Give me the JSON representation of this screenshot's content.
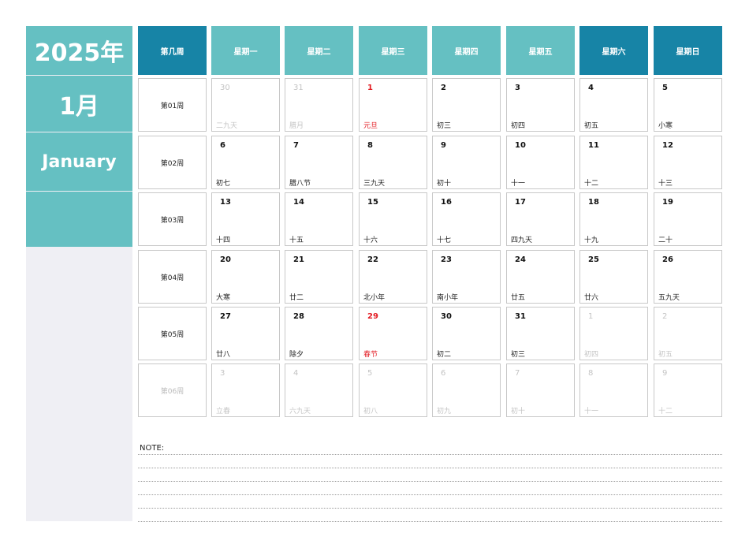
{
  "sidebar": {
    "year": "2025年",
    "month": "1月",
    "month_en": "January"
  },
  "colors": {
    "accent": "#65c0c2",
    "weekend": "#1784a6",
    "sidebar_bg": "#efeff4",
    "holiday": "#e31c23",
    "dim": "#c4c4c4"
  },
  "headers": [
    "第几周",
    "星期一",
    "星期二",
    "星期三",
    "星期四",
    "星期五",
    "星期六",
    "星期日"
  ],
  "weeks": [
    {
      "label": "第01周",
      "dim": false,
      "days": [
        {
          "num": "30",
          "lunar": "二九天",
          "dim": true
        },
        {
          "num": "31",
          "lunar": "腊月",
          "dim": true
        },
        {
          "num": "1",
          "lunar": "元旦",
          "holiday": true
        },
        {
          "num": "2",
          "lunar": "初三"
        },
        {
          "num": "3",
          "lunar": "初四"
        },
        {
          "num": "4",
          "lunar": "初五"
        },
        {
          "num": "5",
          "lunar": "小寒"
        }
      ]
    },
    {
      "label": "第02周",
      "dim": false,
      "days": [
        {
          "num": "6",
          "lunar": "初七"
        },
        {
          "num": "7",
          "lunar": "腊八节"
        },
        {
          "num": "8",
          "lunar": "三九天"
        },
        {
          "num": "9",
          "lunar": "初十"
        },
        {
          "num": "10",
          "lunar": "十一"
        },
        {
          "num": "11",
          "lunar": "十二"
        },
        {
          "num": "12",
          "lunar": "十三"
        }
      ]
    },
    {
      "label": "第03周",
      "dim": false,
      "days": [
        {
          "num": "13",
          "lunar": "十四"
        },
        {
          "num": "14",
          "lunar": "十五"
        },
        {
          "num": "15",
          "lunar": "十六"
        },
        {
          "num": "16",
          "lunar": "十七"
        },
        {
          "num": "17",
          "lunar": "四九天"
        },
        {
          "num": "18",
          "lunar": "十九"
        },
        {
          "num": "19",
          "lunar": "二十"
        }
      ]
    },
    {
      "label": "第04周",
      "dim": false,
      "days": [
        {
          "num": "20",
          "lunar": "大寒"
        },
        {
          "num": "21",
          "lunar": "廿二"
        },
        {
          "num": "22",
          "lunar": "北小年"
        },
        {
          "num": "23",
          "lunar": "南小年"
        },
        {
          "num": "24",
          "lunar": "廿五"
        },
        {
          "num": "25",
          "lunar": "廿六"
        },
        {
          "num": "26",
          "lunar": "五九天"
        }
      ]
    },
    {
      "label": "第05周",
      "dim": false,
      "days": [
        {
          "num": "27",
          "lunar": "廿八"
        },
        {
          "num": "28",
          "lunar": "除夕"
        },
        {
          "num": "29",
          "lunar": "春节",
          "holiday": true
        },
        {
          "num": "30",
          "lunar": "初二"
        },
        {
          "num": "31",
          "lunar": "初三"
        },
        {
          "num": "1",
          "lunar": "初四",
          "dim": true
        },
        {
          "num": "2",
          "lunar": "初五",
          "dim": true
        }
      ]
    },
    {
      "label": "第06周",
      "dim": true,
      "days": [
        {
          "num": "3",
          "lunar": "立春",
          "dim": true
        },
        {
          "num": "4",
          "lunar": "六九天",
          "dim": true
        },
        {
          "num": "5",
          "lunar": "初八",
          "dim": true
        },
        {
          "num": "6",
          "lunar": "初九",
          "dim": true
        },
        {
          "num": "7",
          "lunar": "初十",
          "dim": true
        },
        {
          "num": "8",
          "lunar": "十一",
          "dim": true
        },
        {
          "num": "9",
          "lunar": "十二",
          "dim": true
        }
      ]
    }
  ],
  "note": {
    "label": "NOTE:"
  }
}
